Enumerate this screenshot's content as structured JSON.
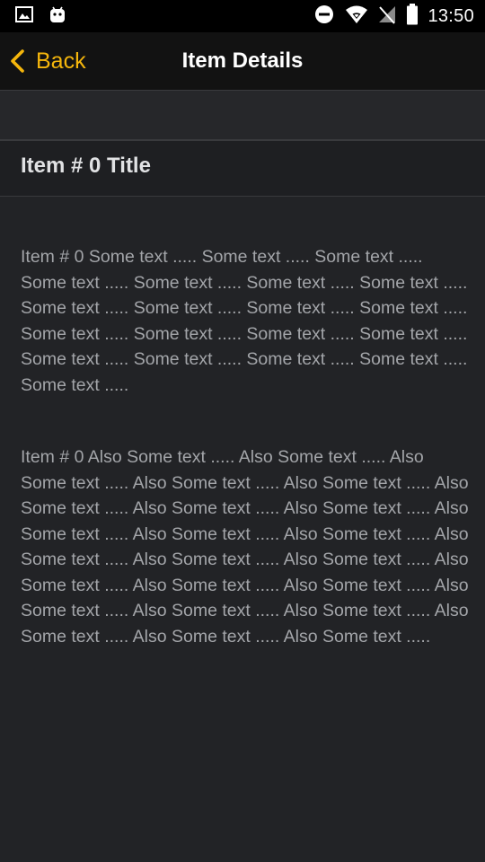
{
  "status_bar": {
    "time": "13:50",
    "left_icons": [
      "image-icon",
      "android-icon"
    ],
    "right_icons": [
      "do-not-disturb-icon",
      "wifi-icon",
      "no-signal-icon",
      "battery-icon"
    ]
  },
  "nav": {
    "back_label": "Back",
    "title": "Item Details"
  },
  "item": {
    "title": "Item # 0 Title",
    "text": "Item # 0 Some text ..... Some text ..... Some text ..... Some text ..... Some text ..... Some text ..... Some text ..... Some text ..... Some text ..... Some text ..... Some text ..... Some text ..... Some text ..... Some text ..... Some text ..... Some text ..... Some text ..... Some text ..... Some text ..... Some text .....",
    "also_text": "Item # 0 Also Some text ..... Also Some text ..... Also Some text ..... Also Some text ..... Also Some text ..... Also Some text ..... Also Some text ..... Also Some text ..... Also Some text ..... Also Some text ..... Also Some text ..... Also Some text ..... Also Some text ..... Also Some text ..... Also Some text ..... Also Some text ..... Also Some text ..... Also Some text ..... Also Some text ..... Also Some text ..... Also Some text ..... Also Some text ..... Also Some text .....",
    "colors": {
      "accent": "#f5b60c",
      "background": "#222326",
      "title_text": "#e1e2e4",
      "body_text": "#a3a5a9"
    }
  }
}
